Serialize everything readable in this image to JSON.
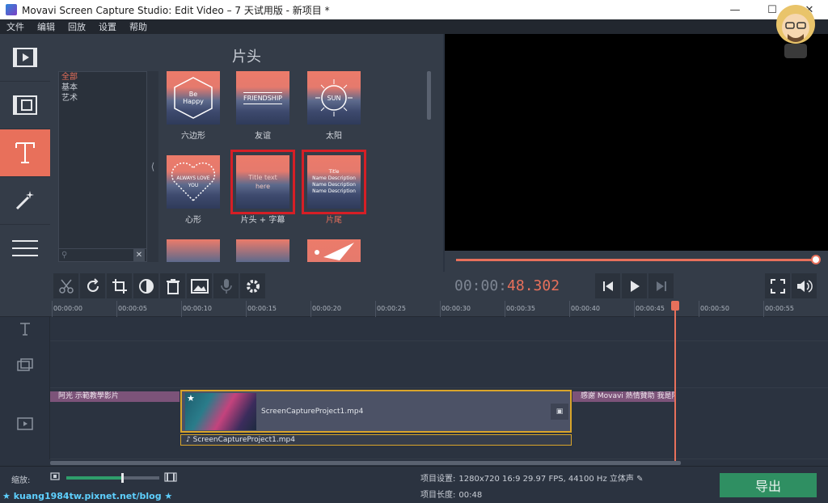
{
  "window": {
    "title": "Movavi Screen Capture Studio: Edit Video – 7 天试用版 - 新项目 *",
    "minimize": "—",
    "maximize": "☐",
    "close": "✕"
  },
  "menu": [
    "文件",
    "编辑",
    "回放",
    "设置",
    "帮助"
  ],
  "library": {
    "title": "片头",
    "categories": [
      "全部",
      "基本",
      "艺术"
    ],
    "collapse_glyph": "⟨",
    "search_clear": "✕",
    "tiles": [
      {
        "label": "六边形",
        "text": "Be\nHappy"
      },
      {
        "label": "友谊",
        "text": "FRIENDSHIP"
      },
      {
        "label": "太阳",
        "text": "SUN"
      },
      {
        "label": "心形",
        "text": "ALWAYS LOVE\nYOU"
      },
      {
        "label": "片头 + 字幕",
        "text": "Title text\nhere"
      },
      {
        "label": "片尾",
        "text": "Title\nName Description\nName Description\nName Description"
      }
    ]
  },
  "player": {
    "timecode_dim": "00:00:",
    "timecode_live": "48.302"
  },
  "ruler": [
    "00:00:00",
    "00:00:05",
    "00:00:10",
    "00:00:15",
    "00:00:20",
    "00:00:25",
    "00:00:30",
    "00:00:35",
    "00:00:40",
    "00:00:45",
    "00:00:50",
    "00:00:55"
  ],
  "timeline": {
    "title_clip_left": "阿光 示範教學影片",
    "title_clip_right": "感謝 Movavi 熱情贊助 我是阿",
    "video_clip_name": "ScreenCaptureProject1.mp4",
    "audio_clip_name": "ScreenCaptureProject1.mp4",
    "audio_glyph": "♪"
  },
  "status": {
    "zoom_label": "缩放:",
    "project_settings_label": "项目设置:",
    "project_settings_value": "1280x720 16:9 29.97 FPS, 44100 Hz 立体声",
    "project_length_label": "项目长度:",
    "project_length_value": "00:48",
    "zoom_level": 0.6,
    "export_label": "导出"
  },
  "watermark": "★ kuang1984tw.pixnet.net/blog ★",
  "colors": {
    "accent": "#e8705b",
    "export": "#2f8f62",
    "highlight": "#d61f26",
    "clip_border": "#d9a52a"
  }
}
